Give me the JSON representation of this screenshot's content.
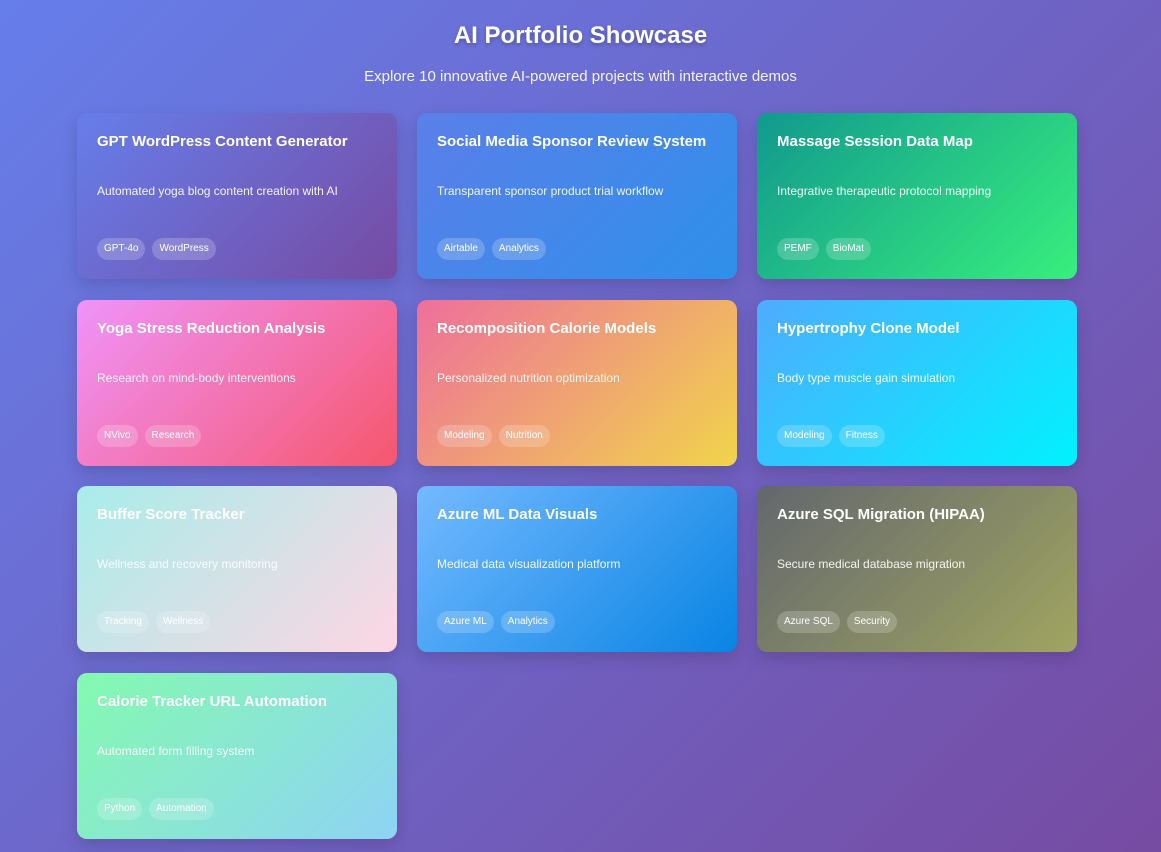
{
  "header": {
    "title": "AI Portfolio Showcase",
    "subtitle": "Explore 10 innovative AI-powered projects with interactive demos"
  },
  "projects": [
    {
      "title": "GPT WordPress Content Generator",
      "description": "Automated yoga blog content creation with AI",
      "tags": [
        "GPT-4o",
        "WordPress"
      ],
      "gradient": [
        "#667eea",
        "#764ba2"
      ]
    },
    {
      "title": "Social Media Sponsor Review System",
      "description": "Transparent sponsor product trial workflow",
      "tags": [
        "Airtable",
        "Analytics"
      ],
      "gradient": [
        "#5b7fe9",
        "#2e90ea"
      ]
    },
    {
      "title": "Massage Session Data Map",
      "description": "Integrative therapeutic protocol mapping",
      "tags": [
        "PEMF",
        "BioMat"
      ],
      "gradient": [
        "#11998e",
        "#38ef7d"
      ]
    },
    {
      "title": "Yoga Stress Reduction Analysis",
      "description": "Research on mind-body interventions",
      "tags": [
        "NVivo",
        "Research"
      ],
      "gradient": [
        "#f093fb",
        "#f5576c"
      ]
    },
    {
      "title": "Recomposition Calorie Models",
      "description": "Personalized nutrition optimization",
      "tags": [
        "Modeling",
        "Nutrition"
      ],
      "gradient": [
        "#ee6f9c",
        "#f0d54a"
      ]
    },
    {
      "title": "Hypertrophy Clone Model",
      "description": "Body type muscle gain simulation",
      "tags": [
        "Modeling",
        "Fitness"
      ],
      "gradient": [
        "#4facfe",
        "#00f2fe"
      ]
    },
    {
      "title": "Buffer Score Tracker",
      "description": "Wellness and recovery monitoring",
      "tags": [
        "Tracking",
        "Wellness"
      ],
      "gradient": [
        "#a8edea",
        "#fed6e3"
      ]
    },
    {
      "title": "Azure ML Data Visuals",
      "description": "Medical data visualization platform",
      "tags": [
        "Azure ML",
        "Analytics"
      ],
      "gradient": [
        "#74b9ff",
        "#0984e3"
      ]
    },
    {
      "title": "Azure SQL Migration (HIPAA)",
      "description": "Secure medical database migration",
      "tags": [
        "Azure SQL",
        "Security"
      ],
      "gradient": [
        "#63676d",
        "#a0a561"
      ]
    },
    {
      "title": "Calorie Tracker URL Automation",
      "description": "Automated form filling system",
      "tags": [
        "Python",
        "Automation"
      ],
      "gradient": [
        "#84fab0",
        "#8fd3f4"
      ]
    }
  ]
}
